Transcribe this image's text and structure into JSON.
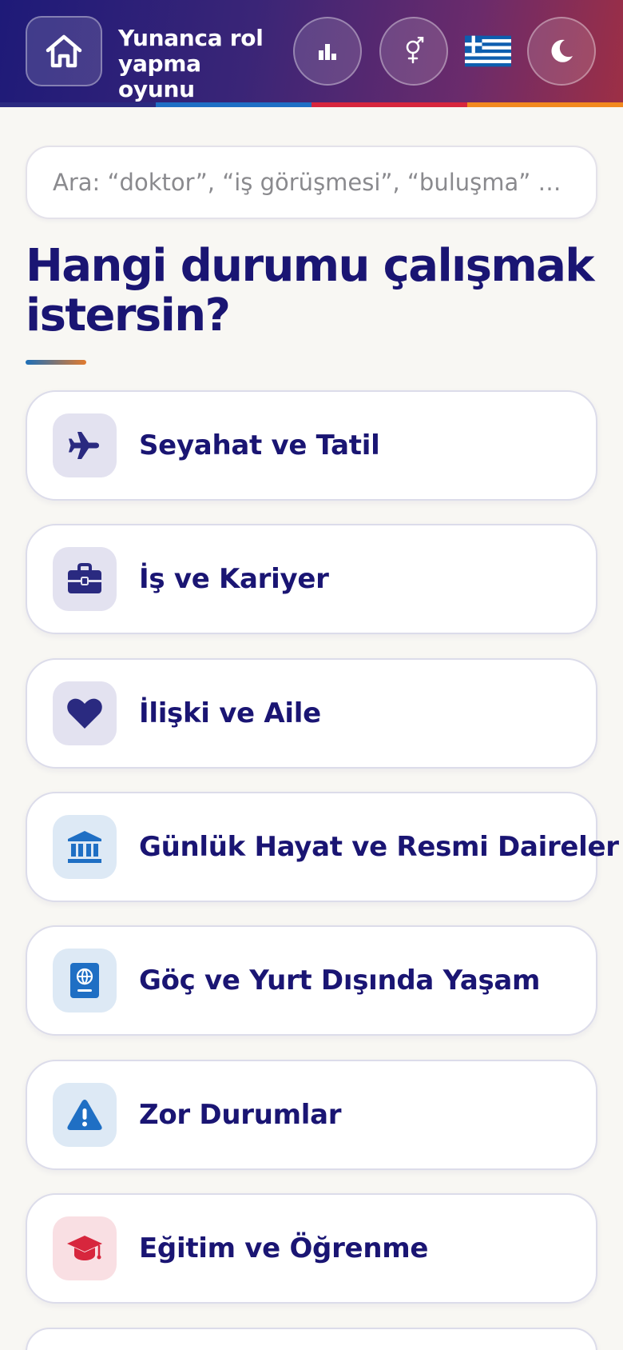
{
  "header": {
    "title": "Yunanca rol yapma oyunu",
    "stripe_colors": [
      "#2b2a80",
      "#1f6fc4",
      "#d7263d",
      "#f2891f"
    ]
  },
  "search": {
    "placeholder": "Ara: “doktor”, “iş görüşmesi”, “buluşma” …",
    "value": ""
  },
  "main": {
    "heading": "Hangi durumu çalışmak istersin?",
    "categories": [
      {
        "label": "Seyahat ve Tatil",
        "icon": "airplane-icon",
        "color": "#2a2a80"
      },
      {
        "label": "İş ve Kariyer",
        "icon": "briefcase-icon",
        "color": "#2a2a80"
      },
      {
        "label": "İlişki ve Aile",
        "icon": "heart-icon",
        "color": "#2a2a80"
      },
      {
        "label": "Günlük Hayat ve Resmi Daireler",
        "icon": "bank-icon",
        "color": "#1f6fc4"
      },
      {
        "label": "Göç ve Yurt Dışında Yaşam",
        "icon": "passport-icon",
        "color": "#1f6fc4"
      },
      {
        "label": "Zor Durumlar",
        "icon": "warning-icon",
        "color": "#1f6fc4"
      },
      {
        "label": "Eğitim ve Öğrenme",
        "icon": "graduation-cap-icon",
        "color": "#d7263d"
      }
    ]
  }
}
